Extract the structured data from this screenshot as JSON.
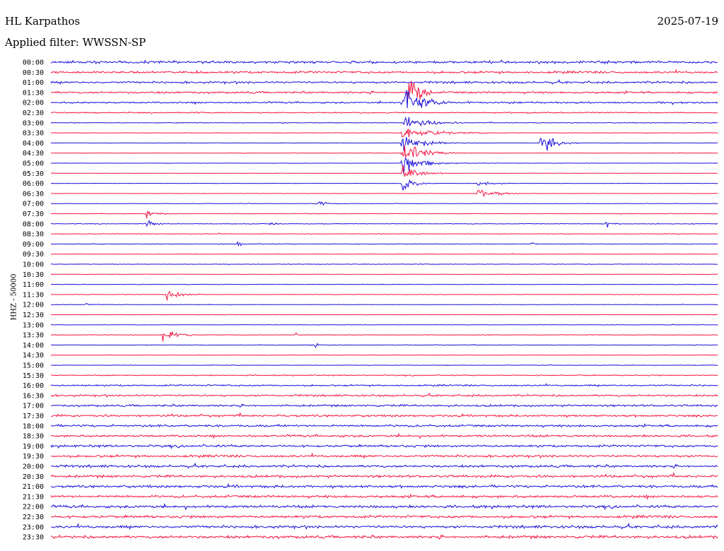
{
  "header": {
    "station": "HL Karpathos",
    "date": "2025-07-19",
    "filter": "Applied filter: WWSSN-SP"
  },
  "channel_label": "HHZ - 50000",
  "chart_data": {
    "type": "line",
    "kind": "helicorder",
    "title": "HL Karpathos",
    "date": "2025-07-19",
    "filter": "WWSSN-SP",
    "ylabel": "HHZ - 50000",
    "colors": [
      "#1a0fd8",
      "#f5143f"
    ],
    "row_labels": [
      "00:00",
      "00:30",
      "01:00",
      "01:30",
      "02:00",
      "02:30",
      "03:00",
      "03:30",
      "04:00",
      "04:30",
      "05:00",
      "05:30",
      "06:00",
      "06:30",
      "07:00",
      "07:30",
      "08:00",
      "08:30",
      "09:00",
      "09:30",
      "10:00",
      "10:30",
      "11:00",
      "11:30",
      "12:00",
      "12:30",
      "13:00",
      "13:30",
      "14:00",
      "14:30",
      "15:00",
      "15:30",
      "16:00",
      "16:30",
      "17:00",
      "17:30",
      "18:00",
      "18:30",
      "19:00",
      "19:30",
      "20:00",
      "20:30",
      "21:00",
      "21:30",
      "22:00",
      "22:30",
      "23:00",
      "23:30"
    ],
    "noise_level": [
      2.2,
      2.0,
      1.9,
      1.8,
      1.5,
      1.0,
      0.7,
      0.5,
      0.4,
      0.4,
      0.35,
      0.35,
      0.35,
      0.35,
      0.45,
      0.55,
      0.6,
      0.6,
      0.55,
      0.5,
      0.45,
      0.45,
      0.45,
      0.45,
      0.4,
      0.4,
      0.45,
      0.5,
      0.5,
      0.45,
      0.5,
      0.9,
      1.4,
      1.7,
      1.8,
      1.9,
      2.0,
      2.0,
      2.1,
      2.1,
      2.2,
      2.2,
      2.3,
      2.3,
      2.4,
      2.4,
      2.4,
      2.5
    ],
    "events": [
      {
        "row": 3,
        "minute": 16.1,
        "amplitude": 90,
        "duration_min": 1.0
      },
      {
        "row": 4,
        "minute": 15.9,
        "amplitude": 60,
        "duration_min": 2.0
      },
      {
        "row": 6,
        "minute": 15.9,
        "amplitude": 16,
        "duration_min": 3.0
      },
      {
        "row": 7,
        "minute": 15.8,
        "amplitude": 16,
        "duration_min": 4.0
      },
      {
        "row": 8,
        "minute": 15.8,
        "amplitude": 20,
        "duration_min": 3.0
      },
      {
        "row": 8,
        "minute": 22.3,
        "amplitude": 14,
        "duration_min": 1.5
      },
      {
        "row": 9,
        "minute": 15.8,
        "amplitude": 28,
        "duration_min": 3.0
      },
      {
        "row": 10,
        "minute": 15.8,
        "amplitude": 26,
        "duration_min": 2.5
      },
      {
        "row": 11,
        "minute": 15.8,
        "amplitude": 22,
        "duration_min": 2.0
      },
      {
        "row": 12,
        "minute": 15.8,
        "amplitude": 20,
        "duration_min": 1.5
      },
      {
        "row": 12,
        "minute": 19.2,
        "amplitude": 10,
        "duration_min": 1.5
      },
      {
        "row": 13,
        "minute": 19.2,
        "amplitude": 12,
        "duration_min": 2.0
      },
      {
        "row": 14,
        "minute": 12.1,
        "amplitude": 10,
        "duration_min": 0.8
      },
      {
        "row": 15,
        "minute": 4.3,
        "amplitude": 8,
        "duration_min": 1.5
      },
      {
        "row": 16,
        "minute": 4.3,
        "amplitude": 10,
        "duration_min": 1.2
      },
      {
        "row": 16,
        "minute": 9.9,
        "amplitude": 10,
        "duration_min": 0.5
      },
      {
        "row": 16,
        "minute": 25.0,
        "amplitude": 10,
        "duration_min": 0.5
      },
      {
        "row": 18,
        "minute": 8.4,
        "amplitude": 10,
        "duration_min": 0.5
      },
      {
        "row": 18,
        "minute": 21.6,
        "amplitude": 7,
        "duration_min": 0.5
      },
      {
        "row": 8,
        "minute": 22.0,
        "amplitude": 18,
        "duration_min": 1.5
      },
      {
        "row": 23,
        "minute": 5.2,
        "amplitude": 20,
        "duration_min": 1.5
      },
      {
        "row": 27,
        "minute": 5.0,
        "amplitude": 22,
        "duration_min": 1.5
      },
      {
        "row": 24,
        "minute": 1.6,
        "amplitude": 6,
        "duration_min": 0.5
      },
      {
        "row": 27,
        "minute": 11.0,
        "amplitude": 7,
        "duration_min": 0.5
      },
      {
        "row": 28,
        "minute": 11.9,
        "amplitude": 7,
        "duration_min": 0.5
      }
    ]
  }
}
